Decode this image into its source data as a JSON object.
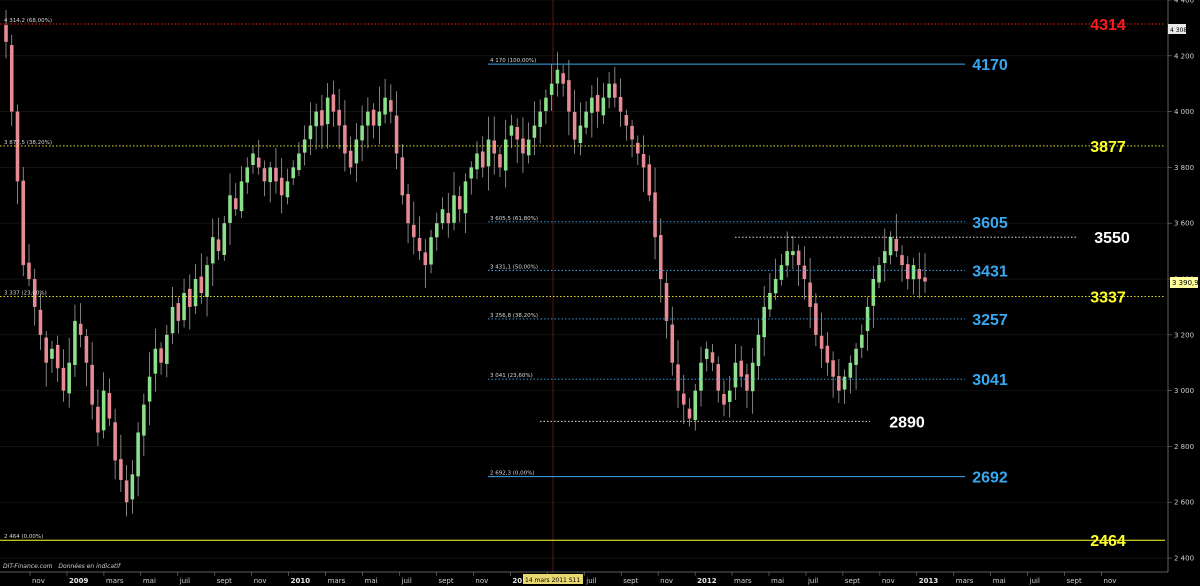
{
  "colors": {
    "background": "#000000",
    "candle_up": "#8be08b",
    "candle_down": "#e88a94",
    "wick": "#b8b8b8",
    "blue": "#3aa8ef",
    "yellow": "#ffff2a",
    "red": "#ff1a1a",
    "white": "#ffffff",
    "grid": "#1c1c1c"
  },
  "credit": {
    "source": "DIT-Finance.com",
    "note": "Données en indicatif"
  },
  "current_price_tag": "3 390,9",
  "top_price_tag": "4 308",
  "event_date_label": "14 mars 2011 S11",
  "chart_data": {
    "type": "candlestick",
    "instrument_period": "weekly",
    "ylim": [
      2350,
      4400
    ],
    "y_ticks": [
      {
        "value": 2400,
        "label": "2 400"
      },
      {
        "value": 2600,
        "label": "2 600"
      },
      {
        "value": 2800,
        "label": "2 800"
      },
      {
        "value": 3000,
        "label": "3 000"
      },
      {
        "value": 3200,
        "label": "3 200"
      },
      {
        "value": 3400,
        "label": "3 400"
      },
      {
        "value": 3600,
        "label": "3 600"
      },
      {
        "value": 3800,
        "label": "3 800"
      },
      {
        "value": 4000,
        "label": "4 000"
      },
      {
        "value": 4200,
        "label": "4 200"
      },
      {
        "value": 4400,
        "label": "4 400"
      }
    ],
    "x_ticks": [
      {
        "label": "nov",
        "bold": false
      },
      {
        "label": "2009",
        "bold": true
      },
      {
        "label": "mars",
        "bold": false
      },
      {
        "label": "mai",
        "bold": false
      },
      {
        "label": "juil",
        "bold": false
      },
      {
        "label": "sept",
        "bold": false
      },
      {
        "label": "nov",
        "bold": false
      },
      {
        "label": "2010",
        "bold": true
      },
      {
        "label": "mars",
        "bold": false
      },
      {
        "label": "mai",
        "bold": false
      },
      {
        "label": "juil",
        "bold": false
      },
      {
        "label": "sept",
        "bold": false
      },
      {
        "label": "nov",
        "bold": false
      },
      {
        "label": "2011",
        "bold": true
      },
      {
        "label": "mai",
        "bold": false
      },
      {
        "label": "juil",
        "bold": false
      },
      {
        "label": "sept",
        "bold": false
      },
      {
        "label": "nov",
        "bold": false
      },
      {
        "label": "2012",
        "bold": true
      },
      {
        "label": "mars",
        "bold": false
      },
      {
        "label": "mai",
        "bold": false
      },
      {
        "label": "juil",
        "bold": false
      },
      {
        "label": "sept",
        "bold": false
      },
      {
        "label": "nov",
        "bold": false
      },
      {
        "label": "2013",
        "bold": true
      },
      {
        "label": "mars",
        "bold": false
      },
      {
        "label": "mai",
        "bold": false
      },
      {
        "label": "juil",
        "bold": false
      },
      {
        "label": "sept",
        "bold": false
      },
      {
        "label": "nov",
        "bold": false
      }
    ],
    "levels": [
      {
        "value": 4314,
        "label": "4314",
        "color": "red",
        "style": "dotted",
        "span": "full",
        "small_label": "4 314,2 (68,00%)"
      },
      {
        "value": 4170,
        "label": "4170",
        "color": "blue",
        "style": "solid",
        "span": "fib",
        "small_label": "4 170 (100,00%)"
      },
      {
        "value": 3877,
        "label": "3877",
        "color": "yellow",
        "style": "dotted",
        "span": "full",
        "small_label": "3 877,5 (38,20%)"
      },
      {
        "value": 3605,
        "label": "3605",
        "color": "blue",
        "style": "dotted",
        "span": "fib",
        "small_label": "3 605,5 (61,80%)"
      },
      {
        "value": 3550,
        "label": "3550",
        "color": "white",
        "style": "dotted",
        "span": "short_upper",
        "small_label": ""
      },
      {
        "value": 3431,
        "label": "3431",
        "color": "blue",
        "style": "dotted",
        "span": "fib",
        "small_label": "3 431,1 (50,00%)"
      },
      {
        "value": 3337,
        "label": "3337",
        "color": "yellow",
        "style": "dotted",
        "span": "full",
        "small_label": "3 337 (23,60%)"
      },
      {
        "value": 3257,
        "label": "3257",
        "color": "blue",
        "style": "dotted",
        "span": "fib",
        "small_label": "3 256,8 (38,20%)"
      },
      {
        "value": 3041,
        "label": "3041",
        "color": "blue",
        "style": "dotted",
        "span": "fib",
        "small_label": "3 041 (23,60%)"
      },
      {
        "value": 2890,
        "label": "2890",
        "color": "white",
        "style": "dotted",
        "span": "short_lower",
        "small_label": ""
      },
      {
        "value": 2692,
        "label": "2692",
        "color": "blue",
        "style": "solid",
        "span": "fib",
        "small_label": "2 692,3 (0,00%)"
      },
      {
        "value": 2464,
        "label": "2464",
        "color": "yellow",
        "style": "solid",
        "span": "full",
        "small_label": "2 464 (0,00%)"
      }
    ],
    "closes": [
      4250,
      4000,
      3750,
      3450,
      3400,
      3300,
      3200,
      3100,
      3150,
      3080,
      3000,
      3100,
      3250,
      3200,
      3100,
      2950,
      2850,
      3000,
      2900,
      2750,
      2680,
      2600,
      2700,
      2850,
      2950,
      3050,
      3150,
      3100,
      3200,
      3300,
      3250,
      3350,
      3300,
      3400,
      3350,
      3450,
      3550,
      3500,
      3600,
      3700,
      3650,
      3750,
      3800,
      3850,
      3800,
      3750,
      3800,
      3750,
      3700,
      3750,
      3800,
      3850,
      3900,
      3950,
      4000,
      3950,
      4050,
      4000,
      3950,
      3850,
      3800,
      3900,
      3950,
      4000,
      3950,
      4000,
      4050,
      4000,
      3850,
      3700,
      3600,
      3550,
      3500,
      3450,
      3550,
      3600,
      3650,
      3600,
      3700,
      3650,
      3750,
      3800,
      3850,
      3800,
      3900,
      3850,
      3800,
      3900,
      3950,
      3900,
      3850,
      3900,
      3950,
      4000,
      4050,
      4100,
      4150,
      4100,
      4000,
      3900,
      3950,
      4000,
      4050,
      4000,
      4050,
      4100,
      4050,
      4000,
      3950,
      3900,
      3850,
      3800,
      3700,
      3550,
      3400,
      3250,
      3100,
      3000,
      2950,
      2900,
      3000,
      3100,
      3150,
      3100,
      3000,
      2950,
      3000,
      3100,
      3050,
      3000,
      3100,
      3200,
      3300,
      3350,
      3400,
      3450,
      3500,
      3500,
      3450,
      3400,
      3300,
      3200,
      3150,
      3100,
      3050,
      3000,
      3050,
      3100,
      3150,
      3200,
      3300,
      3400,
      3450,
      3500,
      3550,
      3500,
      3450,
      3400,
      3450,
      3400,
      3391
    ]
  }
}
